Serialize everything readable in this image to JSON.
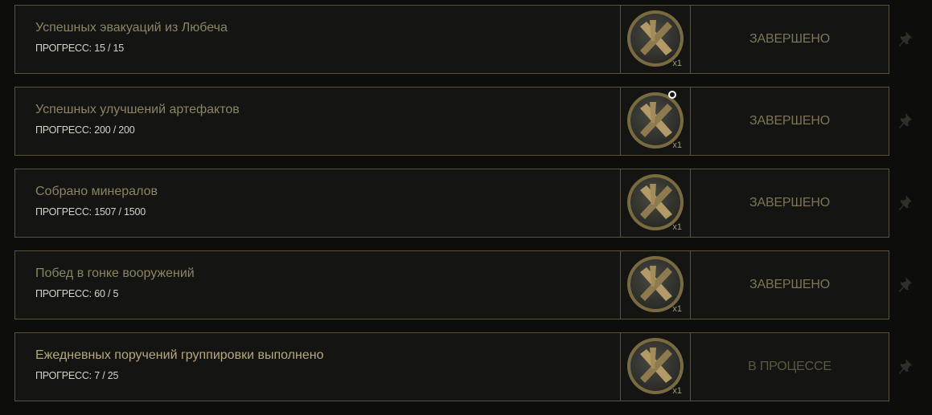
{
  "achievements": [
    {
      "title": "Успешных эвакуаций из Любеча",
      "progress": "ПРОГРЕСС: 15 / 15",
      "reward_icon": "crossed-tools-medal-icon",
      "reward_qty": "x1",
      "status": "ЗАВЕРШЕНО"
    },
    {
      "title": "Успешных улучшений артефактов",
      "progress": "ПРОГРЕСС: 200 / 200",
      "reward_icon": "crossed-tools-medal-icon",
      "reward_qty": "x1",
      "status": "ЗАВЕРШЕНО"
    },
    {
      "title": "Собрано минералов",
      "progress": "ПРОГРЕСС: 1507 / 1500",
      "reward_icon": "crossed-tools-medal-icon",
      "reward_qty": "x1",
      "status": "ЗАВЕРШЕНО"
    },
    {
      "title": "Побед в гонке вооружений",
      "progress": "ПРОГРЕСС: 60 / 5",
      "reward_icon": "crossed-tools-medal-icon",
      "reward_qty": "x1",
      "status": "ЗАВЕРШЕНО"
    },
    {
      "title": "Ежедневных поручений группировки выполнено",
      "progress": "ПРОГРЕСС: 7 / 25",
      "reward_icon": "crossed-tools-medal-icon",
      "reward_qty": "x1",
      "status": "В ПРОЦЕССЕ"
    }
  ],
  "pin_icon": "pin-icon",
  "colors": {
    "background": "#0d0d0c",
    "row_background": "#141412",
    "border": "#595337",
    "title_completed": "#8d8461",
    "title_active": "#b6a87a",
    "status_completed": "#7d7553",
    "status_active": "#5e5841",
    "progress_text": "#d5d2c8"
  }
}
